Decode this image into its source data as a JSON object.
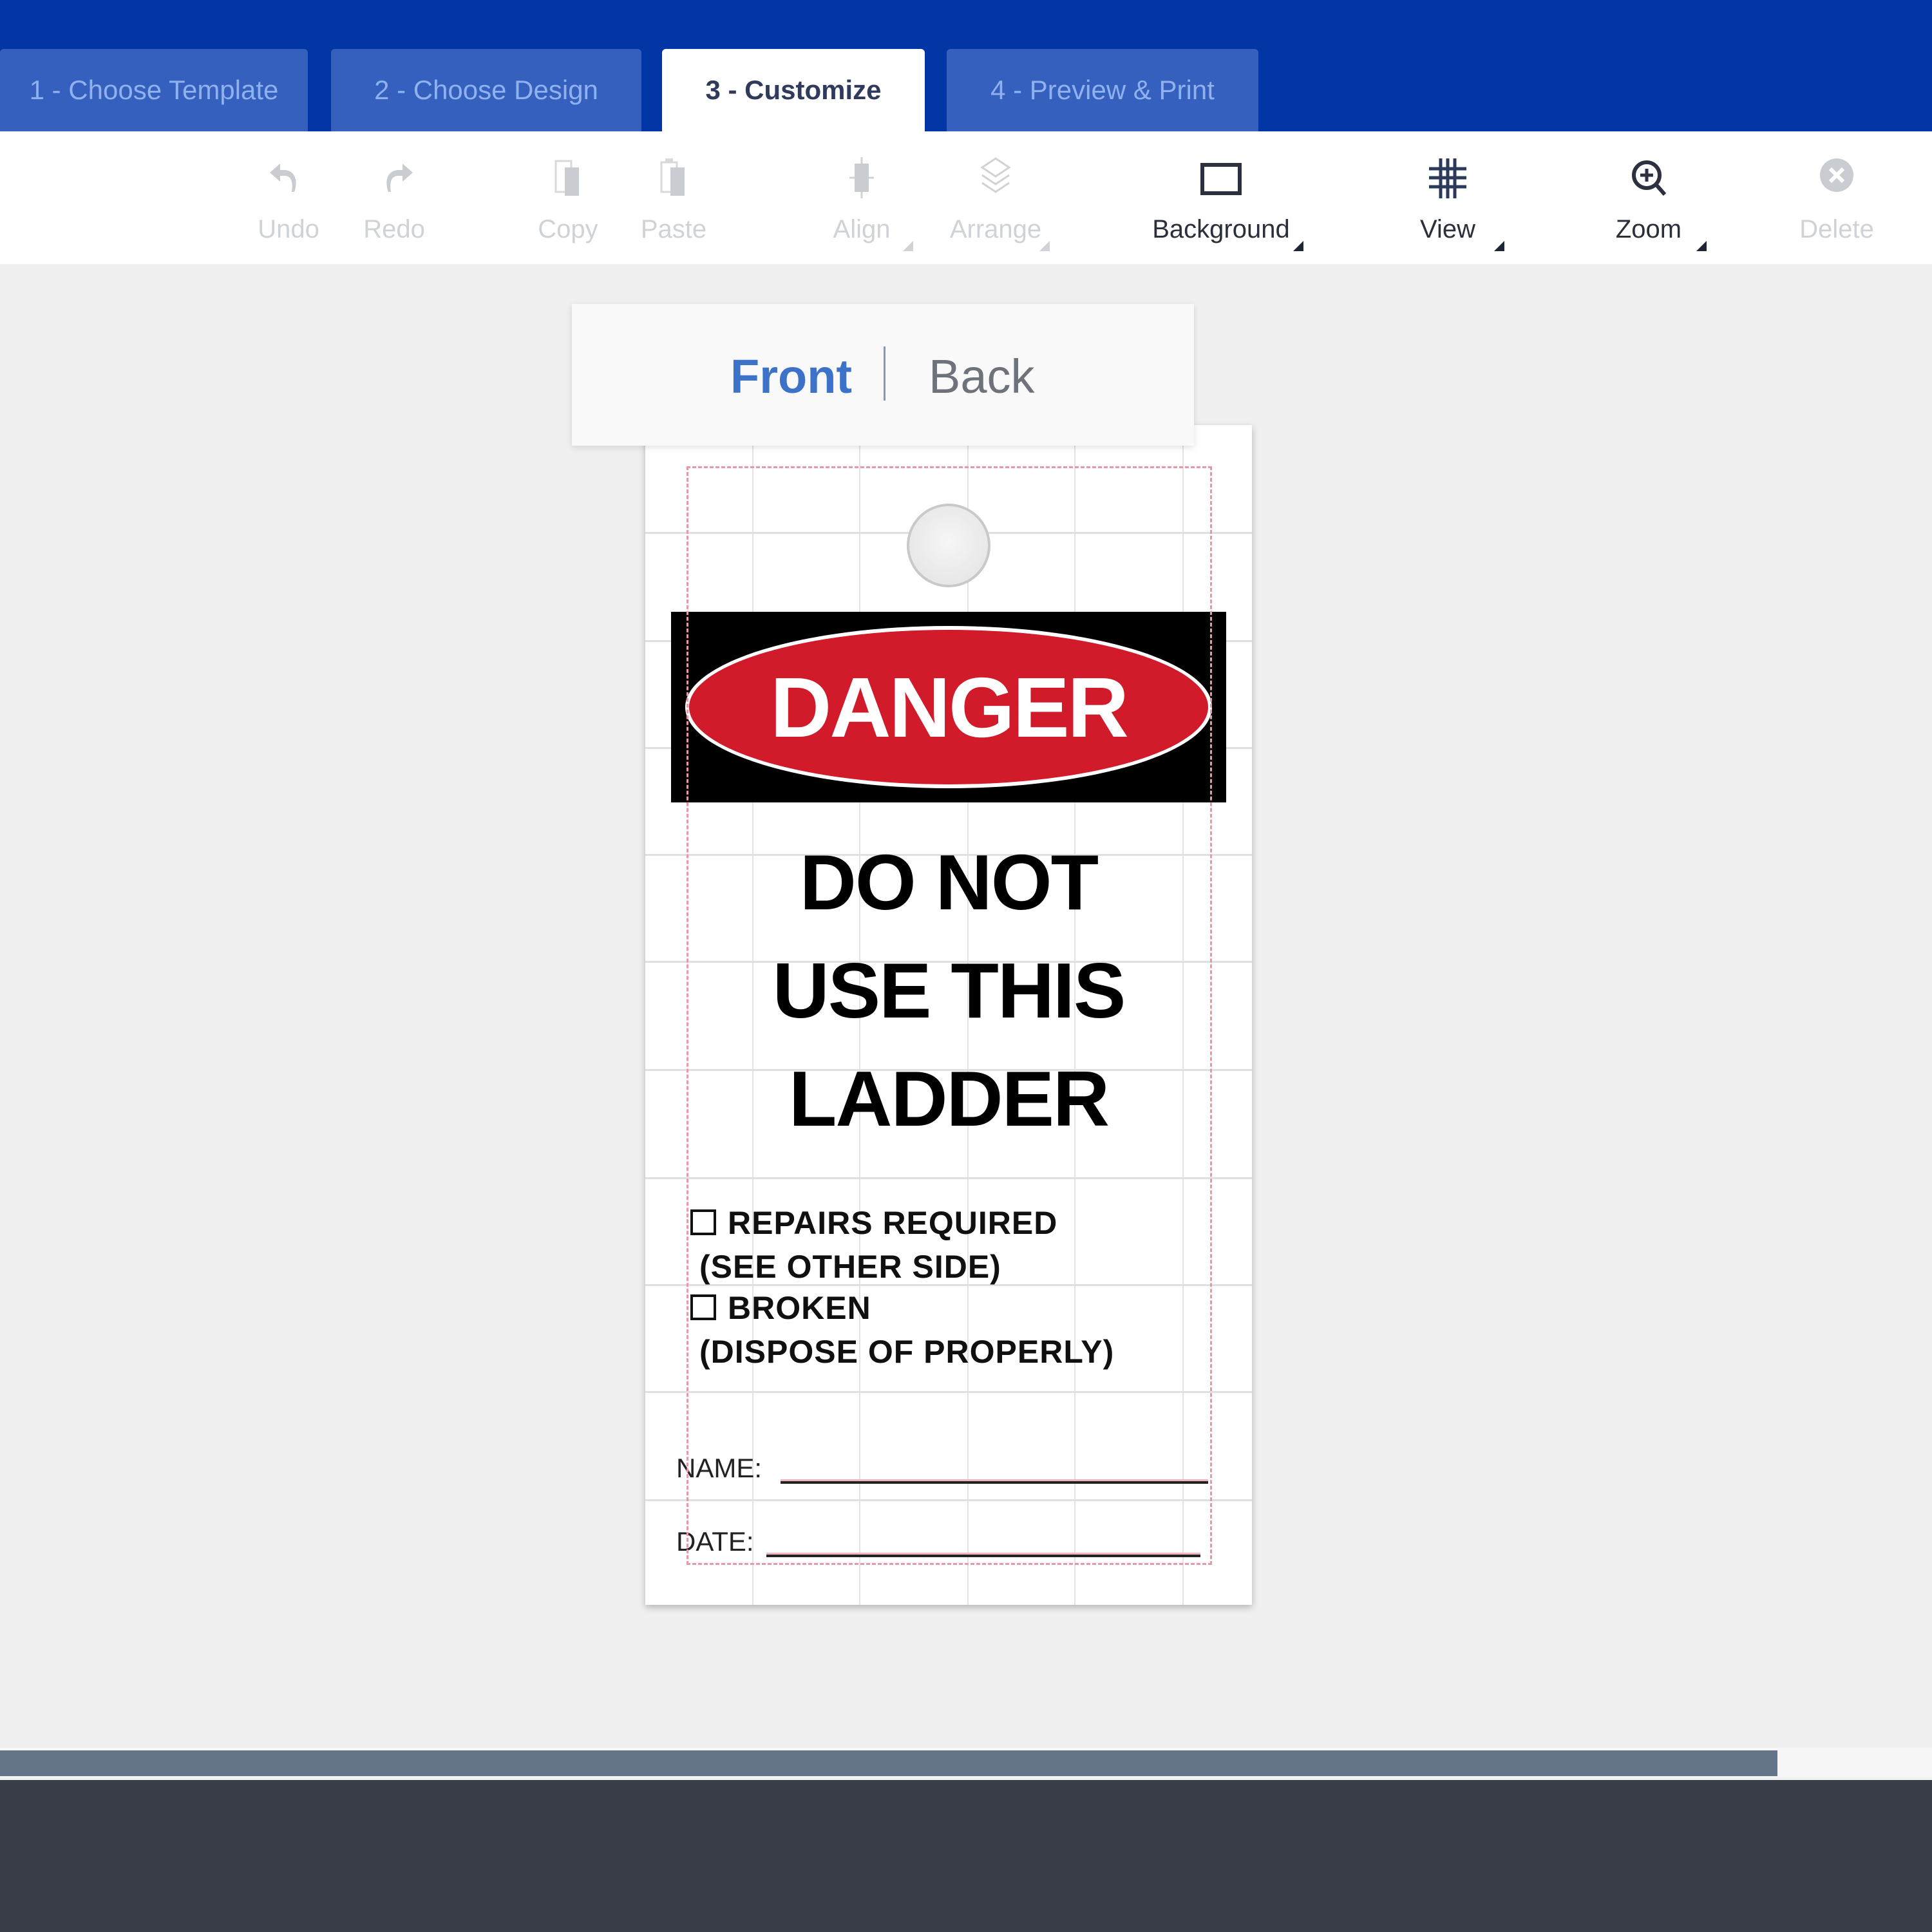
{
  "colors": {
    "header_bg": "#0236a4",
    "tab_bg": "#3560be",
    "tab_text": "#8fb1ee",
    "active_tab_text": "#2f3a5c",
    "front_active": "#3d72c9",
    "danger_red": "#d11a2a",
    "scrollbar_thumb": "#657589",
    "footer_bg": "#393d47"
  },
  "steps": [
    {
      "label": "1 - Choose Template",
      "active": false
    },
    {
      "label": "2 - Choose Design",
      "active": false
    },
    {
      "label": "3 - Customize",
      "active": true
    },
    {
      "label": "4 - Preview & Print",
      "active": false
    }
  ],
  "toolbar": {
    "undo": {
      "label": "Undo",
      "icon": "undo-icon",
      "enabled": false
    },
    "redo": {
      "label": "Redo",
      "icon": "redo-icon",
      "enabled": false
    },
    "copy": {
      "label": "Copy",
      "icon": "copy-icon",
      "enabled": false
    },
    "paste": {
      "label": "Paste",
      "icon": "paste-icon",
      "enabled": false
    },
    "align": {
      "label": "Align",
      "icon": "align-center-icon",
      "enabled": false,
      "dropdown": true
    },
    "arrange": {
      "label": "Arrange",
      "icon": "layers-icon",
      "enabled": false,
      "dropdown": true
    },
    "background": {
      "label": "Background",
      "icon": "rectangle-icon",
      "enabled": true,
      "dropdown": true
    },
    "view": {
      "label": "View",
      "icon": "grid-icon",
      "enabled": true,
      "dropdown": true
    },
    "zoom": {
      "label": "Zoom",
      "icon": "zoom-in-icon",
      "enabled": true,
      "dropdown": true
    },
    "delete": {
      "label": "Delete",
      "icon": "close-circle-icon",
      "enabled": false
    }
  },
  "side_switch": {
    "front": "Front",
    "back": "Back",
    "selected": "Front"
  },
  "tag": {
    "header_word": "DANGER",
    "headline": [
      "DO NOT",
      "USE THIS",
      "LADDER"
    ],
    "checklist": [
      {
        "box": "☐",
        "text": "REPAIRS REQUIRED",
        "sub": "(SEE OTHER SIDE)"
      },
      {
        "box": "☐",
        "text": "BROKEN",
        "sub": "(DISPOSE OF PROPERLY)"
      }
    ],
    "fields": [
      {
        "label": "NAME:",
        "value": ""
      },
      {
        "label": "DATE:",
        "value": ""
      }
    ]
  },
  "scrollbar": {
    "horizontal_thumb_fraction": 0.92
  }
}
